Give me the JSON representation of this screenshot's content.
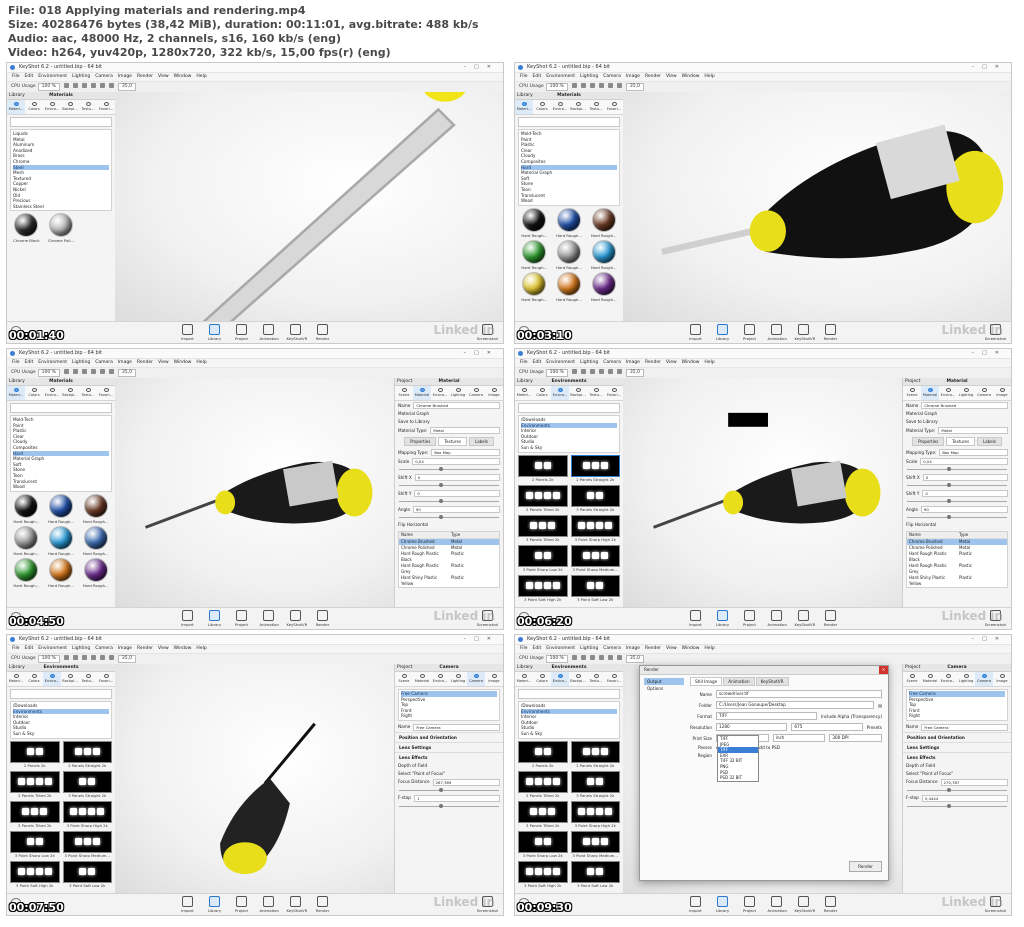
{
  "header": {
    "line1": "File: 018 Applying materials and rendering.mp4",
    "line2": "Size: 40286476 bytes (38,42 MiB), duration: 00:11:01, avg.bitrate: 488 kb/s",
    "line3": "Audio: aac, 48000 Hz, 2 channels, s16, 160 kb/s (eng)",
    "line4": "Video: h264, yuv420p, 1280x720, 322 kb/s, 15,00 fps(r) (eng)"
  },
  "app": {
    "title": "KeyShot 6.2  -  untitled.bip  -  64 bit",
    "menu": [
      "File",
      "Edit",
      "Environment",
      "Lighting",
      "Camera",
      "Image",
      "Render",
      "View",
      "Window",
      "Help"
    ],
    "cpu_label": "CPU Usage",
    "cpu_value": "100 %",
    "fov_value": "35,0",
    "bottom_items": [
      "Import",
      "Library",
      "Project",
      "Animation",
      "KeyShotVR",
      "Render"
    ],
    "screenshot_label": "Screenshot",
    "watermark": "Linked in"
  },
  "library": {
    "label": "Library",
    "tabs": [
      "Materi...",
      "Colors",
      "Enviro...",
      "Backpl...",
      "Textu...",
      "Favori..."
    ]
  },
  "frames": [
    {
      "timestamp": "00:01:40",
      "panel_title": "Materials",
      "tree": [
        "Liquids",
        "Metal",
        "Aluminum",
        "Anodized",
        "Brass",
        "Chrome",
        "Steel",
        "Mesh",
        "Textured",
        "Copper",
        "Nickel",
        "Old",
        "Precious",
        "Stainless Steel"
      ],
      "tree_selected": 6,
      "swatches": [
        {
          "label": "Chrome Black",
          "color": "#2a2a2a"
        },
        {
          "label": "Chrome Poli...",
          "color": "#b9b9b9"
        }
      ]
    },
    {
      "timestamp": "00:03:10",
      "panel_title": "Materials",
      "tree": [
        "Mold-Tech",
        "Paint",
        "Plastic",
        "Clear",
        "Cloudy",
        "Composites",
        "Hard",
        "Material Graph",
        "Soft",
        "Stone",
        "Toon",
        "Translucent",
        "Wood"
      ],
      "tree_selected": 6,
      "swatches": [
        {
          "label": "Hard Rough...",
          "color": "#111111"
        },
        {
          "label": "Hard Rough...",
          "color": "#1f4fa8"
        },
        {
          "label": "Hard Rough...",
          "color": "#6b3a24"
        },
        {
          "label": "Hard Rough...",
          "color": "#2f9a2f"
        },
        {
          "label": "Hard Rough...",
          "color": "#9a9a9a"
        },
        {
          "label": "Hard Rough...",
          "color": "#2a9ad6"
        },
        {
          "label": "Hard Rough...",
          "color": "#e0c530"
        },
        {
          "label": "Hard Rough...",
          "color": "#d4781c"
        },
        {
          "label": "Hard Rough...",
          "color": "#6a2a8a"
        }
      ]
    },
    {
      "timestamp": "00:04:50",
      "panel_title": "Materials",
      "tree": [
        "Mold-Tech",
        "Paint",
        "Plastic",
        "Clear",
        "Cloudy",
        "Composites",
        "Hard",
        "Material Graph",
        "Soft",
        "Stone",
        "Toon",
        "Translucent",
        "Wood"
      ],
      "tree_selected": 6,
      "swatches": [
        {
          "label": "Hard Rough...",
          "color": "#111111"
        },
        {
          "label": "Hard Rough...",
          "color": "#1f4fa8"
        },
        {
          "label": "Hard Rough...",
          "color": "#6b3a24"
        },
        {
          "label": "Hard Rough...",
          "color": "#9a9a9a"
        },
        {
          "label": "Hard Rough...",
          "color": "#2a9ad6"
        },
        {
          "label": "Hard Rough...",
          "color": "#3a6ab0"
        },
        {
          "label": "Hard Rough...",
          "color": "#2f9a2f"
        },
        {
          "label": "Hard Rough...",
          "color": "#d4781c"
        },
        {
          "label": "Hard Rough...",
          "color": "#6a2a8a"
        }
      ]
    },
    {
      "timestamp": "00:06:20",
      "panel_title": "Environments",
      "tree": [
        "/Downloads",
        "Environments",
        "Interior",
        "Outdoor",
        "Studio",
        "Sun & Sky"
      ],
      "tree_selected": 1,
      "envs": [
        "2 Panels 2k",
        "2 Panels Straight 2k",
        "2 Panels Tilted 2k",
        "3 Panels Straight 2k",
        "3 Panels Tilted 2k",
        "3 Point Sharp High 2k",
        "3 Point Sharp Low 2k",
        "3 Point Sharp Medium...",
        "3 Point Soft High 2k",
        "3 Point Soft Low 2k"
      ],
      "env_selected": 1
    },
    {
      "timestamp": "00:07:50",
      "panel_title": "Environments",
      "tree": [
        "/Downloads",
        "Environments",
        "Interior",
        "Outdoor",
        "Studio",
        "Sun & Sky"
      ],
      "tree_selected": 1,
      "envs": [
        "2 Panels 2k",
        "2 Panels Straight 2k",
        "2 Panels Tilted 2k",
        "3 Panels Straight 2k",
        "3 Panels Tilted 2k",
        "3 Point Sharp High 2k",
        "3 Point Sharp Low 2k",
        "3 Point Sharp Medium...",
        "3 Point Soft High 2k",
        "3 Point Soft Low 2k"
      ],
      "env_selected": -1
    },
    {
      "timestamp": "00:09:30",
      "panel_title": "Environments",
      "tree": [
        "/Downloads",
        "Environments",
        "Interior",
        "Outdoor",
        "Studio",
        "Sun & Sky"
      ],
      "tree_selected": 1,
      "envs": [
        "2 Panels 2k",
        "2 Panels Straight 2k",
        "2 Panels Tilted 2k",
        "3 Panels Straight 2k",
        "3 Panels Tilted 2k",
        "3 Point Sharp High 2k",
        "3 Point Sharp Low 2k",
        "3 Point Sharp Medium...",
        "3 Point Soft High 2k",
        "3 Point Soft Low 2k"
      ],
      "env_selected": -1
    }
  ],
  "project_material": {
    "project_label": "Project",
    "title": "Material",
    "tabs": [
      "Scene",
      "Material",
      "Enviro...",
      "Lighting",
      "Camera",
      "Image"
    ],
    "name_label": "Name",
    "name_value": "Chrome Brushed",
    "graph_button": "Material Graph",
    "save_button": "Save to Library",
    "type_label": "Material Type:",
    "type_value": "Metal",
    "sub_tabs": [
      "Properties",
      "Textures",
      "Labels"
    ],
    "mapping_label": "Mapping Type:",
    "mapping_value": "Box Map",
    "scale_label": "Scale",
    "scale_value": "0,04",
    "shiftx_label": "Shift X",
    "shiftx_value": "0",
    "shifty_label": "Shift Y",
    "shifty_value": "0",
    "angle_label": "Angle",
    "angle_value": "90",
    "flip_label": "Flip Horizontal",
    "list_headers": [
      "Name",
      "Type"
    ],
    "list_rows": [
      {
        "name": "Chrome Brushed",
        "type": "Metal"
      },
      {
        "name": "Chrome Polished",
        "type": "Metal"
      },
      {
        "name": "Hard Rough Plastic Black",
        "type": "Plastic"
      },
      {
        "name": "Hard Rough Plastic Grey",
        "type": "Plastic"
      },
      {
        "name": "Hard Shiny Plastic Yellow",
        "type": "Plastic"
      }
    ]
  },
  "project_camera": {
    "project_label": "Project",
    "title": "Camera",
    "tabs": [
      "Scene",
      "Material",
      "Enviro...",
      "Lighting",
      "Camera",
      "Image"
    ],
    "cameras": [
      "Free Camera",
      "Perspective",
      "Top",
      "Front",
      "Right"
    ],
    "name_label": "Name",
    "name_value": "Free Camera",
    "position_section": "Position and Orientation",
    "lens_section": "Lens Settings",
    "effects_section": "Lens Effects",
    "dof_label": "Depth of Field",
    "focus_button": "Select \"Point of Focus\"",
    "focus_distance_label": "Focus Distance",
    "focus_distance_value": "267,369",
    "fstop_label": "F-stop",
    "fstop_value": "1",
    "focus_distance_value_b": "270,787",
    "fstop_value_b": "0,4444"
  },
  "render_dialog": {
    "title": "Render",
    "side_items": [
      "Output",
      "Options"
    ],
    "tabs": [
      "Still Image",
      "Animation",
      "KeyShotVR"
    ],
    "name_label": "Name",
    "name_value": "screwdriver.tif",
    "folder_label": "Folder",
    "folder_value": "C:/Users/Jean Gonoupe/Desktop",
    "format_label": "Format",
    "format_value": "TIFF",
    "alpha_label": "Include Alpha (Transparency)",
    "resolution_label": "Resolution",
    "res_w": "1280",
    "res_h": "675",
    "presets_label": "Presets",
    "print_label": "Print Size",
    "print_w": "4,26333",
    "print_unit": "inch",
    "dpi_value": "300 DPI",
    "passes_label": "Passes",
    "layers_label": "All Render Layers",
    "psd_label": "Add to PSD",
    "region_label": "Region",
    "formats": [
      "TIFF",
      "JPEG",
      "TIFF",
      "EXR",
      "TIFF 32 BIT",
      "PNG",
      "PSD",
      "PSD 32 BIT"
    ],
    "format_selected": 2,
    "render_button": "Render"
  }
}
